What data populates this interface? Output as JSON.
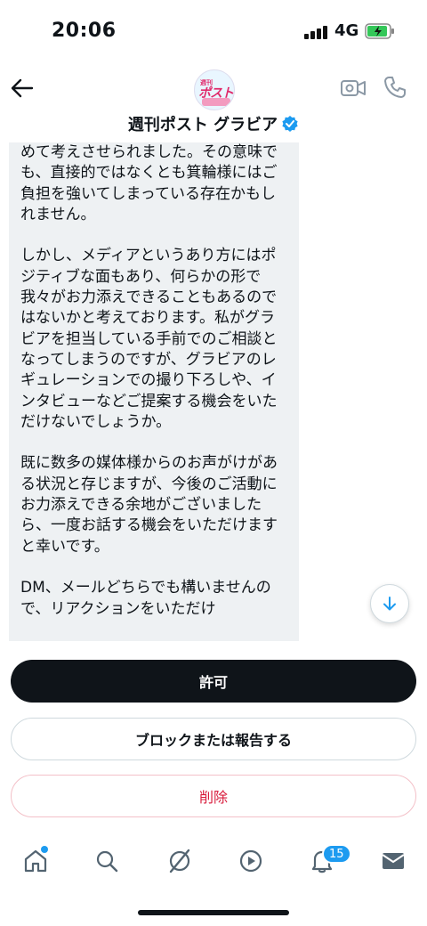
{
  "status_bar": {
    "time": "20:06",
    "network": "4G"
  },
  "header": {
    "contact_name": "週刊ポスト グラビア",
    "avatar_logo": {
      "top": "週刊",
      "middle": "ポスト",
      "bottom": "グラビア"
    }
  },
  "message": {
    "text": "めて考えさせられました。その意味でも、直接的ではなくとも箕輪様にはご負担を強いてしまっている存在かもしれません。\n\nしかし、メディアというあり方にはポジティブな面もあり、何らかの形で我々がお力添えできることもあるのではないかと考えております。私がグラビアを担当している手前でのご相談となってしまうのですが、グラビアのレギュレーションでの撮り下ろしや、インタビューなどご提案する機会をいただけないでしょうか。\n\n既に数多の媒体様からのお声がけがある状況と存じますが、今後のご活動にお力添えできる余地がございましたら、一度お話する機会をいただけますと幸いです。\n\nDM、メールどちらでも構いませんので、リアクションをいただけ"
  },
  "actions": {
    "allow_label": "許可",
    "block_label": "ブロックまたは報告する",
    "delete_label": "削除"
  },
  "tab_bar": {
    "notifications_badge": "15",
    "icons": [
      "home-icon",
      "search-icon",
      "grok-icon",
      "video-icon",
      "bell-icon",
      "mail-icon"
    ]
  },
  "colors": {
    "accent": "#1d9bf0",
    "bubble": "#eef1f3",
    "danger": "#d81b3b",
    "primary_button": "#0f1419"
  }
}
